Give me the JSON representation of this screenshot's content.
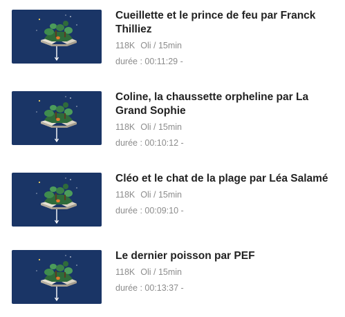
{
  "episodes": [
    {
      "title": "Cueillette et le prince de feu par Franck Thilliez",
      "views": "118K",
      "channel": "Oli / 15min",
      "duration": "durée : 00:11:29 -"
    },
    {
      "title": "Coline, la chaussette orpheline par La Grand Sophie",
      "views": "118K",
      "channel": "Oli / 15min",
      "duration": "durée : 00:10:12 -"
    },
    {
      "title": "Cléo et le chat de la plage par Léa Salamé",
      "views": "118K",
      "channel": "Oli / 15min",
      "duration": "durée : 00:09:10 -"
    },
    {
      "title": "Le dernier poisson par PEF",
      "views": "118K",
      "channel": "Oli / 15min",
      "duration": "durée : 00:13:37 -"
    }
  ],
  "thumbnail": {
    "icon": "floating-book-island-icon",
    "background_color": "#1a3566"
  }
}
